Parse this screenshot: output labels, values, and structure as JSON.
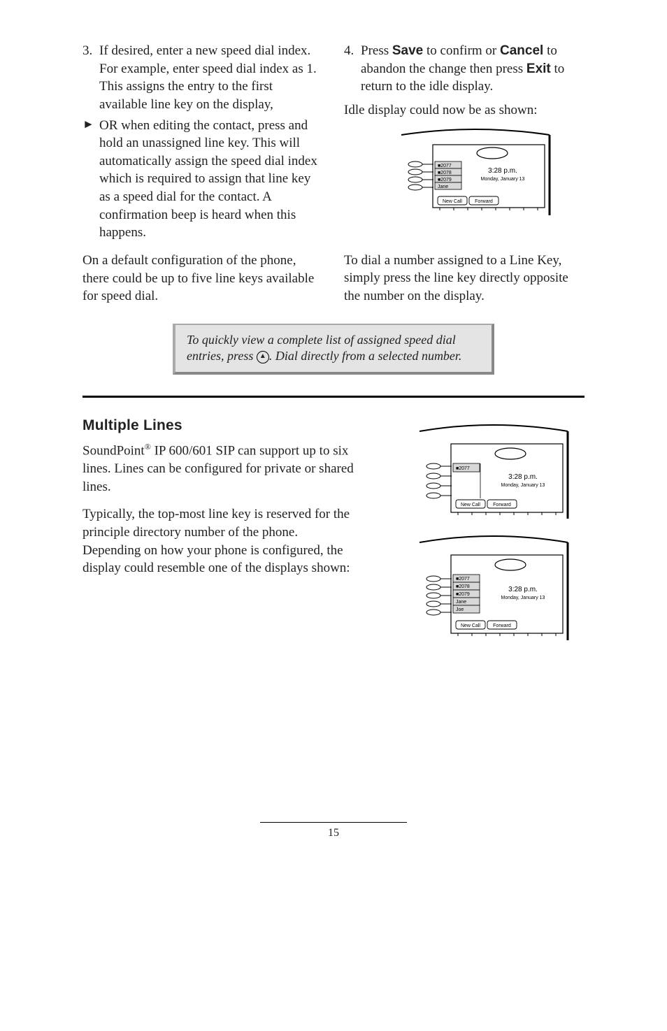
{
  "top": {
    "item3": "If desired, enter a new speed dial index.  For example, enter speed dial index as 1.  This assigns the entry to the first available line key on the display,",
    "arrow_item": "OR when editing the contact, press and hold an unassigned line key.  This will automatically assign the speed dial index which is required to assign that line key as a speed dial for the contact.  A confirmation beep is heard when this happens.",
    "left_para": "On a default configuration of the phone, there could be up to five line keys avail­able for speed dial.",
    "item4_pre": "Press ",
    "item4_save": "Save",
    "item4_mid1": " to confirm or ",
    "item4_cancel": "Cancel",
    "item4_mid2": " to abandon the change then press ",
    "item4_exit": "Exit",
    "item4_post": " to return to the idle display.",
    "right_para1": "Idle display could now be as shown:",
    "right_para2": "To dial a number assigned to a Line Key, simply press the line key directly opposite the number on the display."
  },
  "callout": {
    "line1": "To quickly view a complete list of assigned speed dial",
    "line2_pre": "entries, press ",
    "line2_post": ".  Dial directly from a selected number."
  },
  "multiple_lines": {
    "heading": "Multiple Lines",
    "p1_pre": "SoundPoint",
    "p1_post": " IP 600/601 SIP can support up to six lines.  Lines can be configured for private or shared lines.",
    "p2": "Typically, the top-most line key is reserved for the principle directory number of the phone.  Depending on how your phone is configured, the display could resemble one of the displays shown:"
  },
  "phone_display": {
    "time": "3:28 p.m.",
    "date": "Monday, January 13",
    "btn_newcall": "New Call",
    "btn_forward": "Forward",
    "line_2077": "2077",
    "line_2078": "2078",
    "line_2079": "2079",
    "line_jane": "Jane",
    "line_joe": "Joe"
  },
  "footer": {
    "page_num": "15"
  }
}
